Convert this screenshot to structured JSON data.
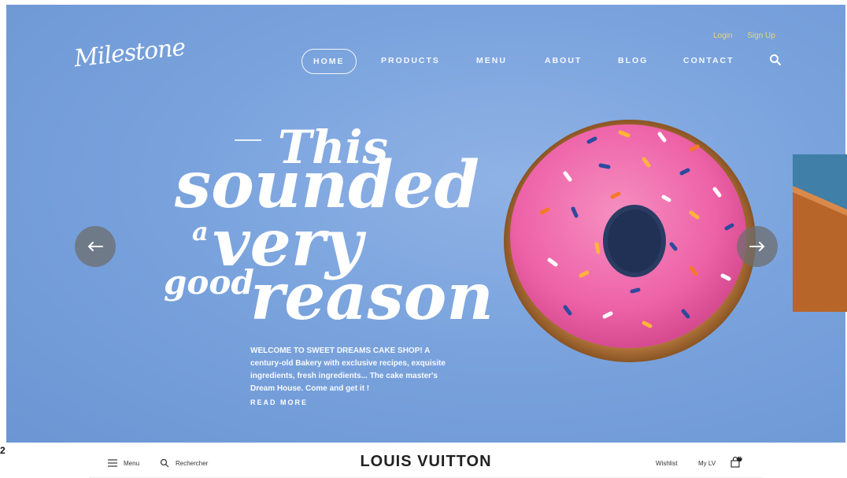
{
  "hero": {
    "logo_text": "Milestone",
    "nav": [
      {
        "label": "HOME",
        "active": true
      },
      {
        "label": "PRODUCTS",
        "active": false
      },
      {
        "label": "MENU",
        "active": false
      },
      {
        "label": "ABOUT",
        "active": false
      },
      {
        "label": "BLOG",
        "active": false
      },
      {
        "label": "CONTACT",
        "active": false
      }
    ],
    "top_links": {
      "login": "Login",
      "signup": "Sign Up"
    },
    "headline": {
      "line1": "This",
      "line2": "sounded",
      "line3a": "a",
      "line3b": "very",
      "line4a": "good",
      "line4b": "reason"
    },
    "intro": "WELCOME TO SWEET DREAMS CAKE SHOP! A century-old Bakery with exclusive recipes, exquisite ingredients, fresh ingredients... The cake master's Dream House. Come and get it !",
    "read_more": "READ MORE",
    "colors": {
      "hero_bg": "#7aa3dd",
      "donut_frosting": "#ee62a8",
      "arrow_bg": "#6e6e6e"
    }
  },
  "lv_header": {
    "menu": "Menu",
    "search": "Rechercher",
    "brand": "LOUIS VUITTON",
    "wishlist": "Wishlist",
    "mylv": "My LV",
    "cart_count": "0"
  },
  "edge_fragment": "2",
  "icons": [
    "search-icon",
    "arrow-left-icon",
    "arrow-right-icon",
    "hamburger-icon",
    "magnifier-icon",
    "bag-icon"
  ]
}
